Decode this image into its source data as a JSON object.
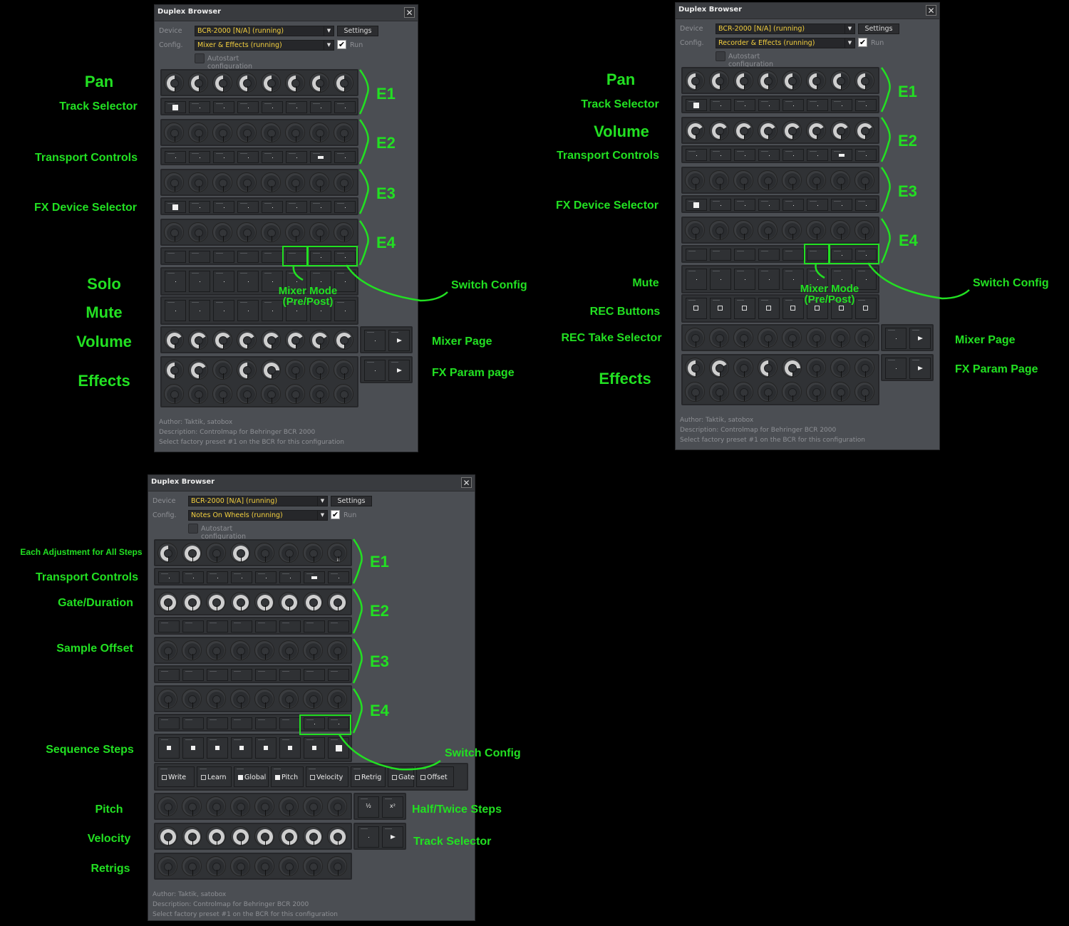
{
  "common": {
    "window_title": "Duplex Browser",
    "close_glyph": "✕",
    "device_label": "Device",
    "device_value": "BCR-2000 [N/A] (running)",
    "config_label": "Config.",
    "settings_label": "Settings",
    "run_label": "Run",
    "run_checked": true,
    "autostart_label": "Autostart configuration",
    "autostart_checked": false,
    "dropdown_glyph": "▼",
    "check_glyph": "✔",
    "info_author": "Author: Taktik, satobox",
    "info_description": "Description: Controlmap for Behringer BCR 2000",
    "info_hint": "Select factory preset #1 on the BCR for this configuration",
    "accent_color": "#22e022",
    "config_text_color": "#f4d03f"
  },
  "windows": [
    {
      "id": "mixer",
      "config_value": "Mixer & Effects (running)",
      "annotations": {
        "left": [
          "Pan",
          "Track Selector",
          "Transport Controls",
          "FX Device Selector",
          "Solo",
          "Mute",
          "Volume",
          "Effects"
        ],
        "encoders": [
          "E1",
          "E2",
          "E3",
          "E4"
        ],
        "mixer_mode": [
          "Mixer Mode",
          "(Pre/Post)"
        ],
        "switch_config": "Switch Config",
        "right": [
          "Mixer Page",
          "FX Param page"
        ]
      }
    },
    {
      "id": "recorder",
      "config_value": "Recorder & Effects (running)",
      "annotations": {
        "left": [
          "Pan",
          "Track Selector",
          "Volume",
          "Transport Controls",
          "FX Device Selector",
          "Mute",
          "REC Buttons",
          "REC Take Selector",
          "Effects"
        ],
        "encoders": [
          "E1",
          "E2",
          "E3",
          "E4"
        ],
        "mixer_mode": [
          "Mixer Mode",
          "(Pre/Post)"
        ],
        "switch_config": "Switch Config",
        "right": [
          "Mixer Page",
          "FX Param Page"
        ]
      }
    },
    {
      "id": "notes",
      "config_value": "Notes On Wheels (running)",
      "annotations": {
        "left": [
          "Each Adjustment for All Steps",
          "Transport Controls",
          "Gate/Duration",
          "Sample Offset",
          "Sequence Steps",
          "Pitch",
          "Velocity",
          "Retrigs"
        ],
        "encoders": [
          "E1",
          "E2",
          "E3",
          "E4"
        ],
        "switch_config": "Switch Config",
        "right": [
          "Half/Twice Steps",
          "Track Selector"
        ]
      },
      "toggles": [
        {
          "label": "Write",
          "checked": false
        },
        {
          "label": "Learn",
          "checked": false
        },
        {
          "label": "Global",
          "checked": true
        },
        {
          "label": "Pitch",
          "checked": true
        },
        {
          "label": "Velocity",
          "checked": false
        },
        {
          "label": "Retrig",
          "checked": false
        },
        {
          "label": "Gate",
          "checked": false
        },
        {
          "label": "Offset",
          "checked": false
        }
      ],
      "half_label": "½",
      "twice_label": "x²"
    }
  ]
}
